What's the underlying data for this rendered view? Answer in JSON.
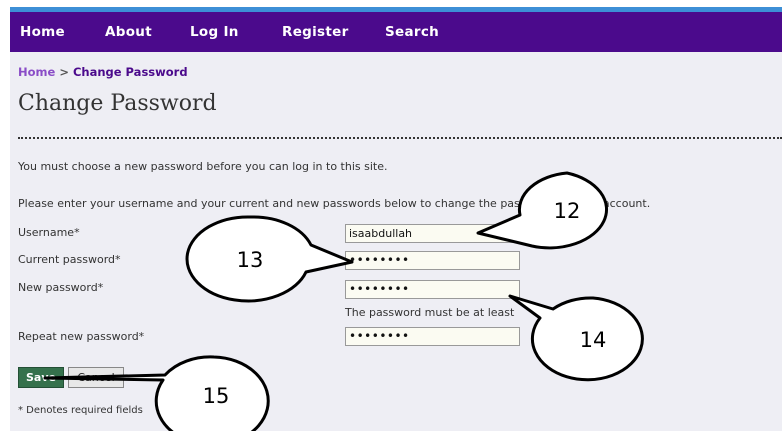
{
  "nav": {
    "items": [
      {
        "label": "Home"
      },
      {
        "label": "About"
      },
      {
        "label": "Log In"
      },
      {
        "label": "Register"
      },
      {
        "label": "Search"
      }
    ]
  },
  "breadcrumb": {
    "home": "Home",
    "separator": ">",
    "current": "Change Password"
  },
  "page": {
    "title": "Change Password",
    "intro": "You must choose a new password before you can log in to this site.",
    "instructions": "Please enter your username and your current and new passwords below to change the password for your account."
  },
  "form": {
    "username": {
      "label": "Username*",
      "value": "isaabdullah"
    },
    "current_password": {
      "label": "Current password*",
      "value": "••••••••"
    },
    "new_password": {
      "label": "New password*",
      "value": "••••••••",
      "hint": "The password must be at least"
    },
    "repeat_password": {
      "label": "Repeat new password*",
      "value": "••••••••"
    },
    "save_label": "Save",
    "cancel_label": "Cancel",
    "required_note": "* Denotes required fields"
  },
  "callouts": [
    {
      "number": "12"
    },
    {
      "number": "13"
    },
    {
      "number": "14"
    },
    {
      "number": "15"
    }
  ],
  "colors": {
    "navbar": "#4b0a8c",
    "page_background": "#eeeef4",
    "save_button": "#35714c",
    "top_strip": "#3d8fd6"
  }
}
